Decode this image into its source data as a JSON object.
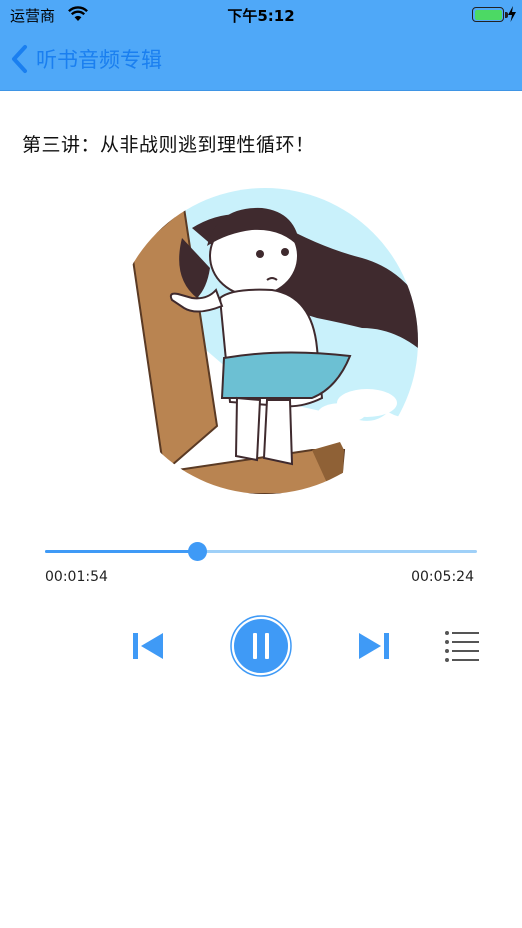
{
  "status_bar": {
    "carrier": "运营商",
    "time": "下午5:12"
  },
  "nav": {
    "title": "听书音频专辑",
    "back_icon": "chevron-left-icon"
  },
  "track": {
    "title": "第三讲：从非战则逃到理性循环！"
  },
  "player": {
    "elapsed": "00:01:54",
    "total": "00:05:24",
    "progress": 0.352,
    "state": "playing"
  },
  "controls": {
    "prev_icon": "skip-previous-icon",
    "play_icon": "pause-icon",
    "next_icon": "skip-next-icon",
    "list_icon": "playlist-icon"
  },
  "colors": {
    "accent": "#3f9af6",
    "nav_bg": "#4fa8f8",
    "nav_text": "#1a7ff0",
    "battery": "#4cd964"
  }
}
